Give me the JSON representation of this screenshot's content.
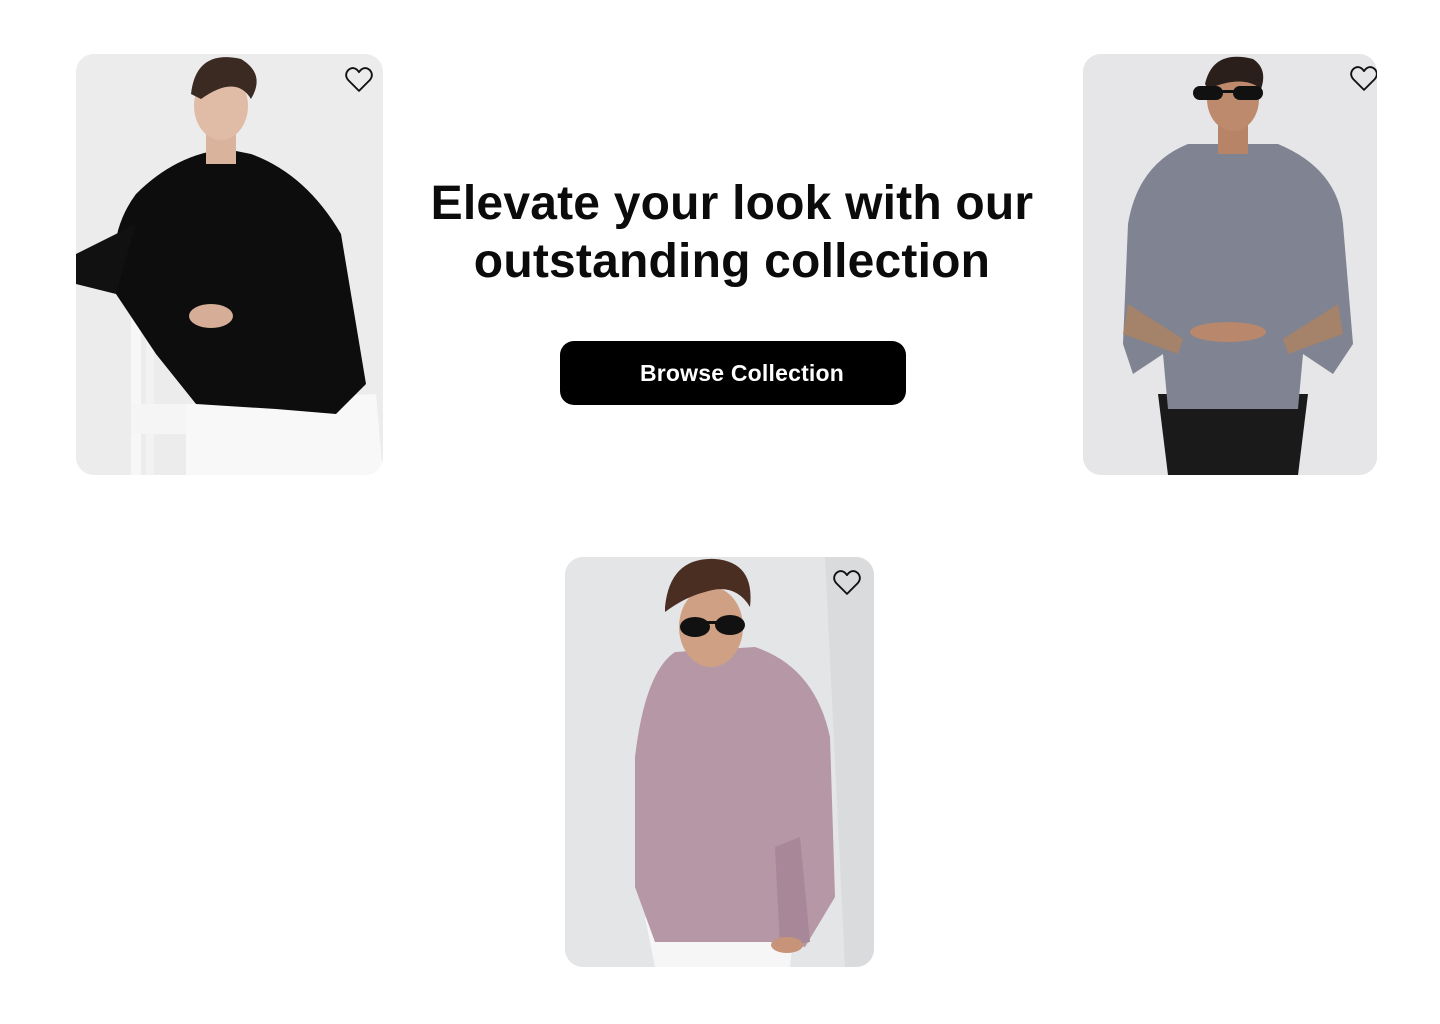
{
  "hero": {
    "title_line1": "Elevate your look with our",
    "title_line2": "outstanding collection",
    "cta_label": "Browse Collection"
  },
  "products": [
    {
      "name": "black-shirt-model",
      "shirt_color": "#0d0d0d",
      "icon": "heart-outline-icon"
    },
    {
      "name": "grey-shirt-model",
      "shirt_color": "#7f8392",
      "icon": "heart-outline-icon"
    },
    {
      "name": "pink-shirt-model",
      "shirt_color": "#b697a6",
      "icon": "heart-outline-icon"
    }
  ],
  "colors": {
    "button_bg": "#000000",
    "button_text": "#ffffff",
    "heading": "#0b0b0b",
    "background": "#ffffff"
  }
}
